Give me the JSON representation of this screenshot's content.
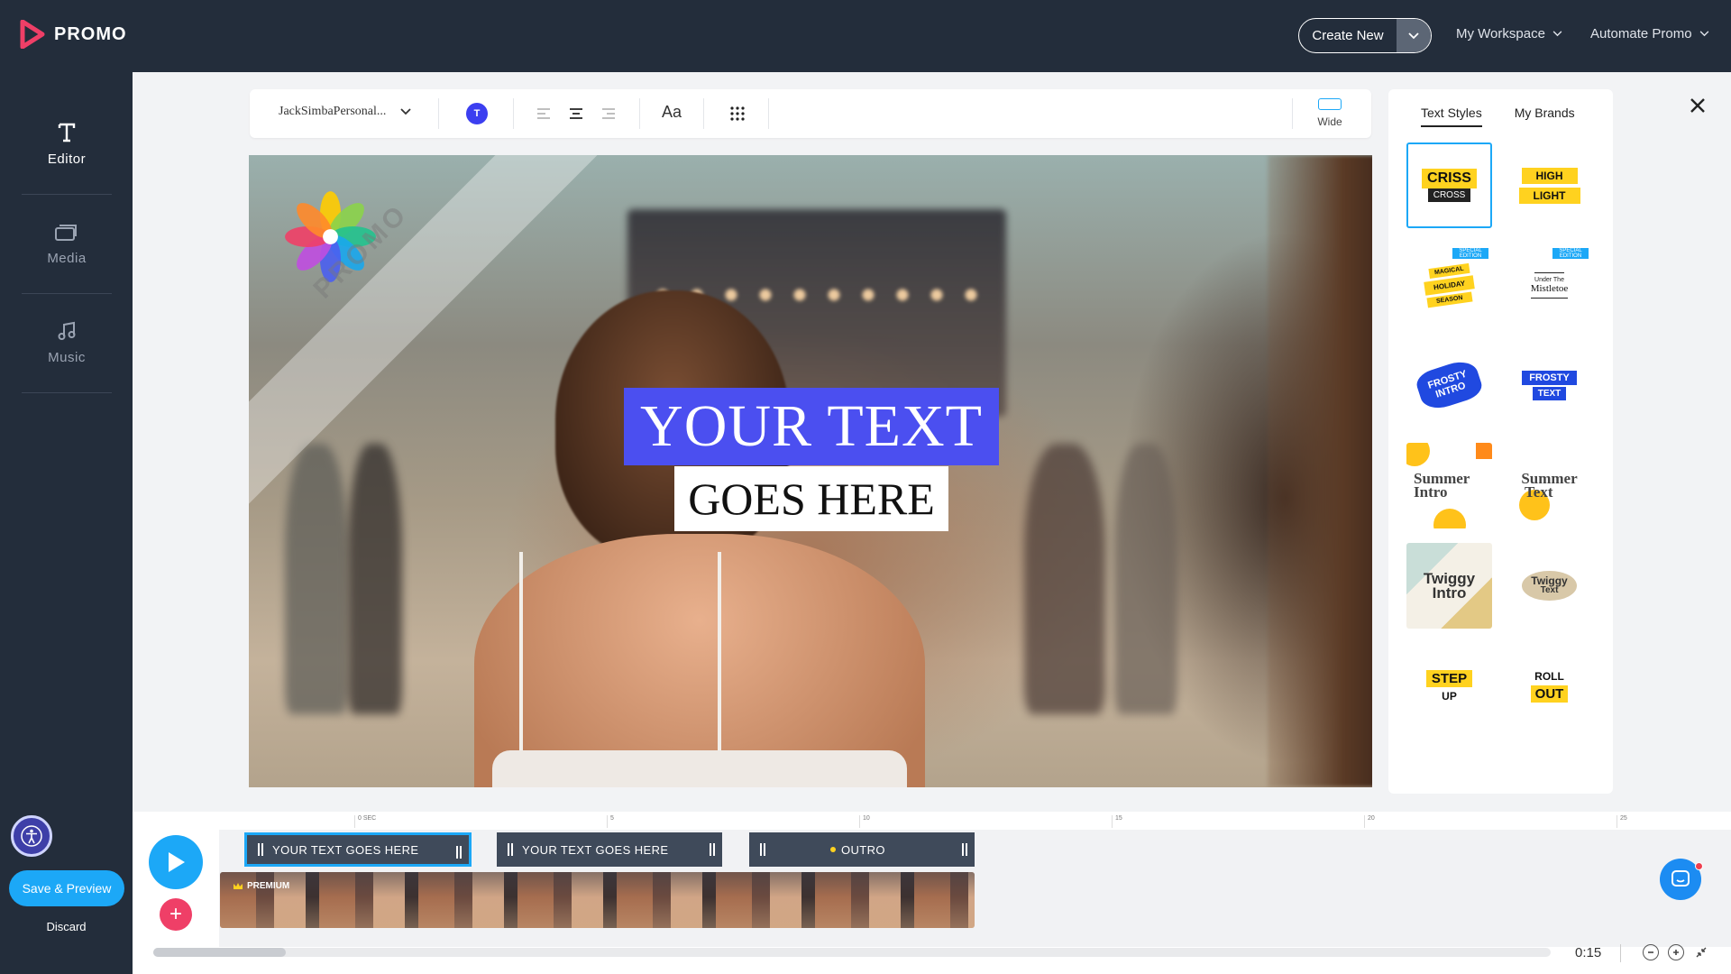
{
  "brand": {
    "name": "PROMO",
    "accent": "#ef3f67"
  },
  "topbar": {
    "create_new": "Create New",
    "workspace": "My Workspace",
    "automate": "Automate Promo"
  },
  "sidebar": {
    "items": [
      {
        "label": "Editor",
        "icon": "text-t-icon",
        "active": true
      },
      {
        "label": "Media",
        "icon": "media-stack-icon",
        "active": false
      },
      {
        "label": "Music",
        "icon": "music-note-icon",
        "active": false
      }
    ],
    "save_label": "Save & Preview",
    "discard_label": "Discard"
  },
  "toolbar": {
    "font_name": "JackSimbaPersonal...",
    "color_letter": "T",
    "color_value": "#3c3ff0",
    "font_size_label": "Aa",
    "aspect_label": "Wide"
  },
  "canvas": {
    "line1": "YOUR TEXT",
    "line2": "GOES HERE",
    "watermark": "PROMO"
  },
  "text_styles": {
    "tabs": [
      "Text Styles",
      "My Brands"
    ],
    "active_tab": 0,
    "cards": [
      {
        "name": "criss-cross",
        "l1": "CRISS",
        "l2": "CROSS",
        "selected": true
      },
      {
        "name": "high-light",
        "l1": "HIGH",
        "l2": "LIGHT"
      },
      {
        "name": "magical-holiday",
        "l1": "MAGICAL",
        "l2": "HOLIDAY",
        "l3": "SEASON",
        "badge": "SPECIAL EDITION"
      },
      {
        "name": "mistletoe",
        "l1": "Under The",
        "l2": "Mistletoe",
        "badge": "SPECIAL EDITION"
      },
      {
        "name": "frosty-intro",
        "l1": "FROSTY",
        "l2": "INTRO"
      },
      {
        "name": "frosty-text",
        "l1": "FROSTY",
        "l2": "TEXT"
      },
      {
        "name": "summer-intro",
        "l1": "Summer",
        "l2": "Intro"
      },
      {
        "name": "summer-text",
        "l1": "Summer",
        "l2": "Text"
      },
      {
        "name": "twiggy-intro",
        "l1": "Twiggy",
        "l2": "Intro"
      },
      {
        "name": "twiggy-text",
        "l1": "Twiggy",
        "l2": "Text"
      },
      {
        "name": "step-up",
        "l1": "STEP",
        "l2": "UP"
      },
      {
        "name": "roll-out",
        "l1": "ROLL",
        "l2": "OUT"
      }
    ]
  },
  "timeline": {
    "ticks": [
      "0 SEC",
      "5",
      "10",
      "15",
      "20",
      "25"
    ],
    "clips": [
      "YOUR TEXT GOES HERE",
      "YOUR TEXT GOES HERE",
      "OUTRO"
    ],
    "premium_label": "PREMIUM",
    "duration": "0:15"
  }
}
